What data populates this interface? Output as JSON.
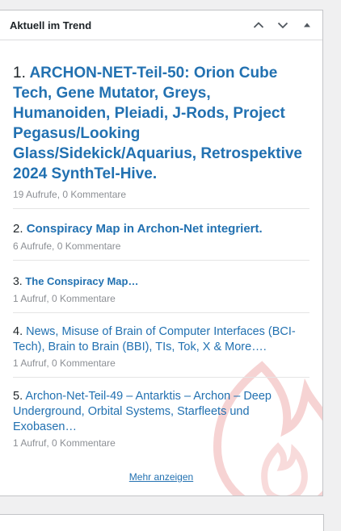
{
  "widget": {
    "title": "Aktuell im Trend",
    "more_label": "Mehr anzeigen"
  },
  "icons": {
    "move_up": "chevron-up-icon",
    "move_down": "chevron-down-icon",
    "toggle": "caret-up-icon",
    "watermark": "flame-icon"
  },
  "colors": {
    "link": "#2271b1",
    "meta": "#8c8f94",
    "watermark": "#d63638"
  },
  "items": [
    {
      "number": "1.",
      "title": "ARCHON-NET-Teil-50: Orion Cube Tech, Gene Mutator, Greys, Humanoiden, Pleiadi, J-Rods, Project Pegasus/Looking Glass/Sidekick/Aquarius, Retrospektive 2024 SynthTel-Hive.",
      "views": "19 Aufrufe",
      "comments": "0 Kommentare"
    },
    {
      "number": "2.",
      "title": "Conspiracy Map in Archon-Net integriert.",
      "views": "6 Aufrufe",
      "comments": "0 Kommentare"
    },
    {
      "number": "3.",
      "title": "The Conspiracy Map…",
      "views": "1 Aufruf",
      "comments": "0 Kommentare"
    },
    {
      "number": "4.",
      "title": "News, Misuse of Brain of Computer Interfaces (BCI-Tech), Brain to Brain (BBI), TIs, Tok, X & More….",
      "views": "1 Aufruf",
      "comments": "0 Kommentare"
    },
    {
      "number": "5.",
      "title": "Archon-Net-Teil-49 – Antarktis – Archon – Deep Underground, Orbital Systems, Starfleets und Exobasen…",
      "views": "1 Aufruf",
      "comments": "0 Kommentare"
    }
  ]
}
